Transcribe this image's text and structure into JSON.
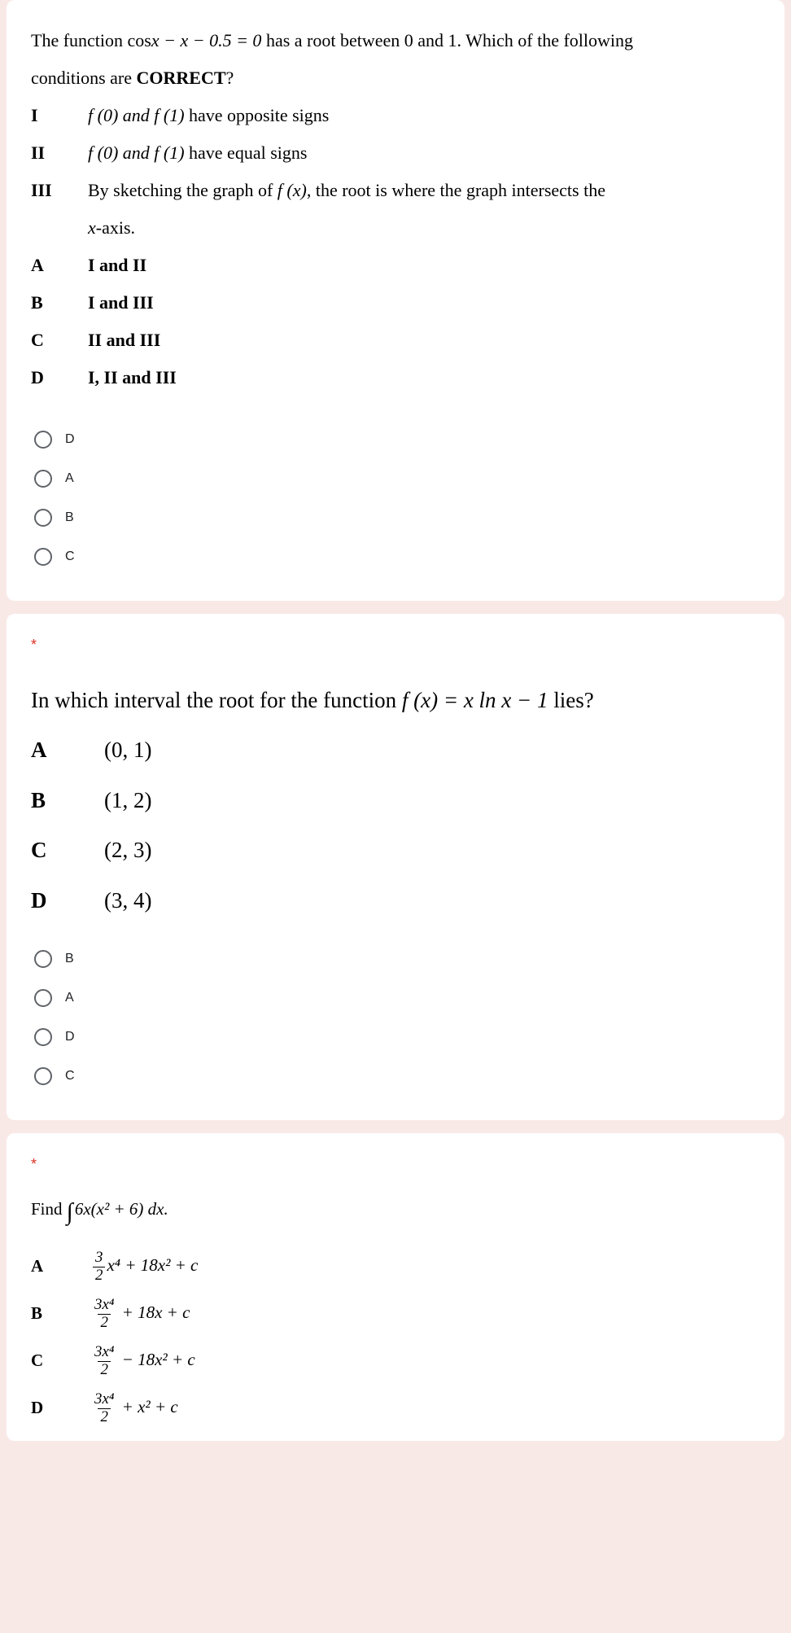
{
  "q1": {
    "stem_line1_a": "The function cos",
    "stem_line1_b": " has a root between 0 and 1. Which of the following",
    "stem_line2": "conditions are ",
    "stem_bold": "CORRECT",
    "stem_q": "?",
    "eq_lhs": "x − x − 0.5 = 0",
    "conditions": [
      {
        "label": "I",
        "text_a": "f (0) and  f (1)",
        "text_b": " have opposite signs"
      },
      {
        "label": "II",
        "text_a": "f (0) and  f (1)",
        "text_b": " have equal signs"
      },
      {
        "label": "III",
        "text_a": "By sketching the graph of ",
        "fx": "f (x)",
        "text_b": ", the root is where the graph intersects the",
        "cont": "x",
        "cont2": "-axis."
      }
    ],
    "choices": [
      {
        "label": "A",
        "text": "I and II"
      },
      {
        "label": "B",
        "text": "I and III"
      },
      {
        "label": "C",
        "text": "II and III"
      },
      {
        "label": "D",
        "text": "I, II and III"
      }
    ],
    "radios": [
      "D",
      "A",
      "B",
      "C"
    ]
  },
  "q2": {
    "required": "*",
    "stem_a": "In which interval the root for the function  ",
    "fx": "f (x) = x ln x − 1",
    "stem_b": "  lies?",
    "choices": [
      {
        "label": "A",
        "text": "(0, 1)"
      },
      {
        "label": "B",
        "text": "(1, 2)"
      },
      {
        "label": "C",
        "text": "(2, 3)"
      },
      {
        "label": "D",
        "text": "(3, 4)"
      }
    ],
    "radios": [
      "B",
      "A",
      "D",
      "C"
    ]
  },
  "q3": {
    "required": "*",
    "stem_a": "Find  ",
    "integrand": "6x(x² + 6) dx.",
    "choices": [
      {
        "label": "A",
        "num": "3",
        "den": "2",
        "rest": "x⁴ + 18x² + c"
      },
      {
        "label": "B",
        "num": "3x⁴",
        "den": "2",
        "rest": " + 18x + c"
      },
      {
        "label": "C",
        "num": "3x⁴",
        "den": "2",
        "rest": " − 18x² + c"
      },
      {
        "label": "D",
        "num": "3x⁴",
        "den": "2",
        "rest": " + x² + c"
      }
    ]
  }
}
